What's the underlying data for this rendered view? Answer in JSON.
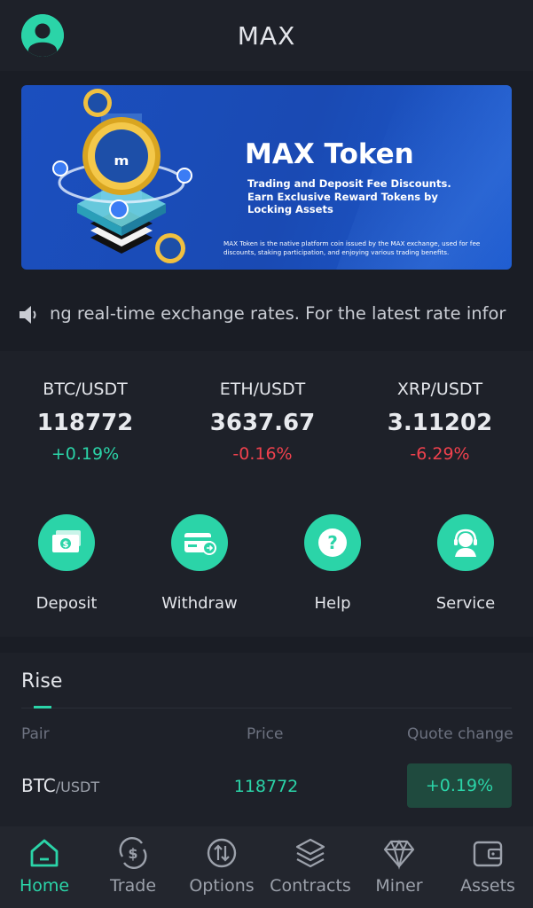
{
  "header": {
    "title": "MAX"
  },
  "banner": {
    "headline": "MAX Token",
    "subtitle": "Trading and Deposit Fee Discounts. Earn Exclusive Reward Tokens by Locking Assets",
    "note": "MAX Token is the native platform coin issued by the MAX exchange, used for fee discounts, staking participation, and enjoying various trading benefits."
  },
  "marquee": {
    "text": "ng real-time exchange rates. For the latest rate infor"
  },
  "tickers": [
    {
      "pair": "BTC/USDT",
      "price": "118772",
      "change": "+0.19%",
      "direction": "up"
    },
    {
      "pair": "ETH/USDT",
      "price": "3637.67",
      "change": "-0.16%",
      "direction": "down"
    },
    {
      "pair": "XRP/USDT",
      "price": "3.11202",
      "change": "-6.29%",
      "direction": "down"
    }
  ],
  "actions": [
    {
      "label": "Deposit",
      "icon": "cash-icon"
    },
    {
      "label": "Withdraw",
      "icon": "card-icon"
    },
    {
      "label": "Help",
      "icon": "question-icon"
    },
    {
      "label": "Service",
      "icon": "headset-icon"
    }
  ],
  "rise": {
    "title": "Rise",
    "columns": {
      "pair": "Pair",
      "price": "Price",
      "change": "Quote change"
    },
    "rows": [
      {
        "base": "BTC",
        "quote": "/USDT",
        "price": "118772",
        "change": "+0.19%"
      }
    ]
  },
  "tabs": [
    {
      "label": "Home",
      "icon": "home-icon",
      "active": true
    },
    {
      "label": "Trade",
      "icon": "dollar-cycle-icon"
    },
    {
      "label": "Options",
      "icon": "swap-arrows-icon"
    },
    {
      "label": "Contracts",
      "icon": "layers-icon"
    },
    {
      "label": "Miner",
      "icon": "diamond-icon"
    },
    {
      "label": "Assets",
      "icon": "wallet-icon"
    }
  ],
  "colors": {
    "accent": "#2bd4a8",
    "down": "#f0414d",
    "background": "#1a1d25",
    "panel": "#1e2129"
  }
}
